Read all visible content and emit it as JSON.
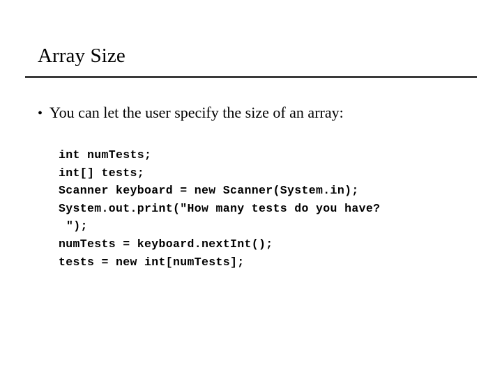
{
  "slide": {
    "title": "Array Size",
    "divider_color": "#3a3a3a",
    "background_color": "#ffffff",
    "text_color": "#000000"
  },
  "body": {
    "bullets": [
      {
        "marker": "•",
        "text": "You can let the user specify the size of an array:"
      }
    ]
  },
  "code": {
    "language": "java",
    "lines": [
      {
        "text": "int numTests;",
        "continuation": false
      },
      {
        "text": "int[] tests;",
        "continuation": false
      },
      {
        "text": "Scanner keyboard = new Scanner(System.in);",
        "continuation": false
      },
      {
        "text": "System.out.print(\"How many tests do you have?",
        "continuation": false
      },
      {
        "text": "\");",
        "continuation": true
      },
      {
        "text": "numTests = keyboard.nextInt();",
        "continuation": false
      },
      {
        "text": "tests = new int[numTests];",
        "continuation": false
      }
    ]
  }
}
